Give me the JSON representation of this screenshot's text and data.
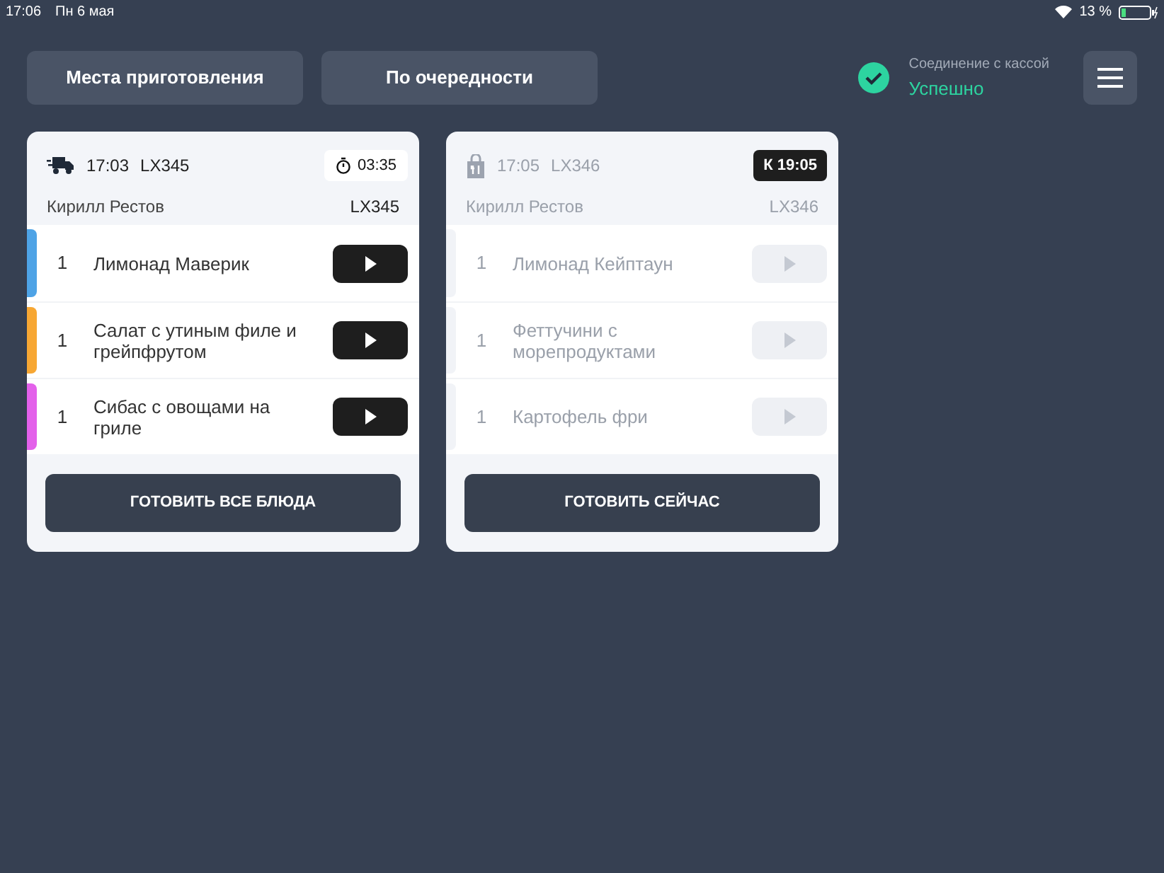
{
  "status_bar": {
    "time": "17:06",
    "date": "Пн 6 мая",
    "battery": "13 %"
  },
  "toolbar": {
    "buttons": [
      "Места приготовления",
      "По очередности"
    ],
    "connection": {
      "label": "Соединение с кассой",
      "value": "Успешно",
      "ok": true
    }
  },
  "orders": [
    {
      "kind": "delivery",
      "time": "17:03",
      "code": "LX345",
      "badge": {
        "kind": "timer",
        "text": "03:35"
      },
      "customer": "Кирилл Рестов",
      "ref": "LX345",
      "disabled": false,
      "items": [
        {
          "qty": "1",
          "name": "Лимонад Маверик",
          "color": "#4ea3e6"
        },
        {
          "qty": "1",
          "name": "Салат с утиным филе и грейпфрутом",
          "color": "#f7a733"
        },
        {
          "qty": "1",
          "name": "Сибас с овощами на гриле",
          "color": "#e361ea"
        }
      ],
      "action": "ГОТОВИТЬ ВСЕ БЛЮДА"
    },
    {
      "kind": "takeaway",
      "time": "17:05",
      "code": "LX346",
      "badge": {
        "kind": "deadline",
        "text": "К 19:05"
      },
      "customer": "Кирилл Рестов",
      "ref": "LX346",
      "disabled": true,
      "items": [
        {
          "qty": "1",
          "name": "Лимонад Кейптаун",
          "color": "#f1f3f7"
        },
        {
          "qty": "1",
          "name": "Феттучини с морепродуктами",
          "color": "#f1f3f7"
        },
        {
          "qty": "1",
          "name": "Картофель фри",
          "color": "#f1f3f7"
        }
      ],
      "action": "ГОТОВИТЬ СЕЙЧАС"
    }
  ]
}
